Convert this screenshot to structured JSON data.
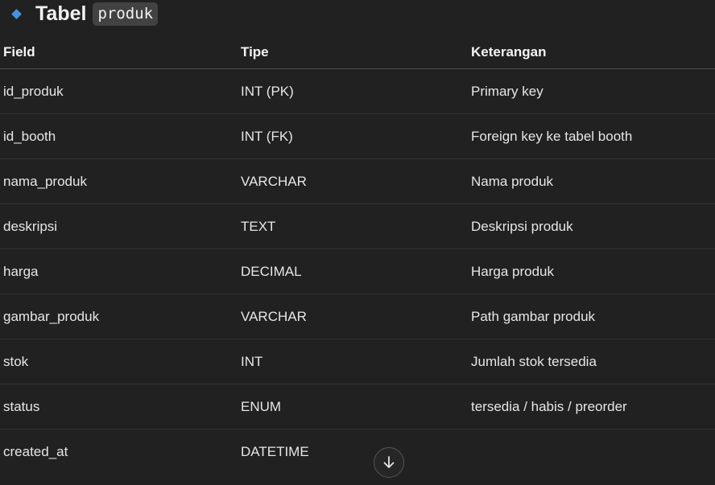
{
  "heading": {
    "icon": "diamond-bullet-icon",
    "accent_color": "#4a90e2",
    "text": "Tabel",
    "code": "produk"
  },
  "table": {
    "headers": [
      "Field",
      "Tipe",
      "Keterangan"
    ],
    "rows": [
      [
        "id_produk",
        "INT (PK)",
        "Primary key"
      ],
      [
        "id_booth",
        "INT (FK)",
        "Foreign key ke tabel booth"
      ],
      [
        "nama_produk",
        "VARCHAR",
        "Nama produk"
      ],
      [
        "deskripsi",
        "TEXT",
        "Deskripsi produk"
      ],
      [
        "harga",
        "DECIMAL",
        "Harga produk"
      ],
      [
        "gambar_produk",
        "VARCHAR",
        "Path gambar produk"
      ],
      [
        "stok",
        "INT",
        "Jumlah stok tersedia"
      ],
      [
        "status",
        "ENUM",
        "tersedia / habis / preorder"
      ],
      [
        "created_at",
        "DATETIME",
        ""
      ]
    ]
  },
  "scroll_button": {
    "icon": "arrow-down-icon"
  }
}
